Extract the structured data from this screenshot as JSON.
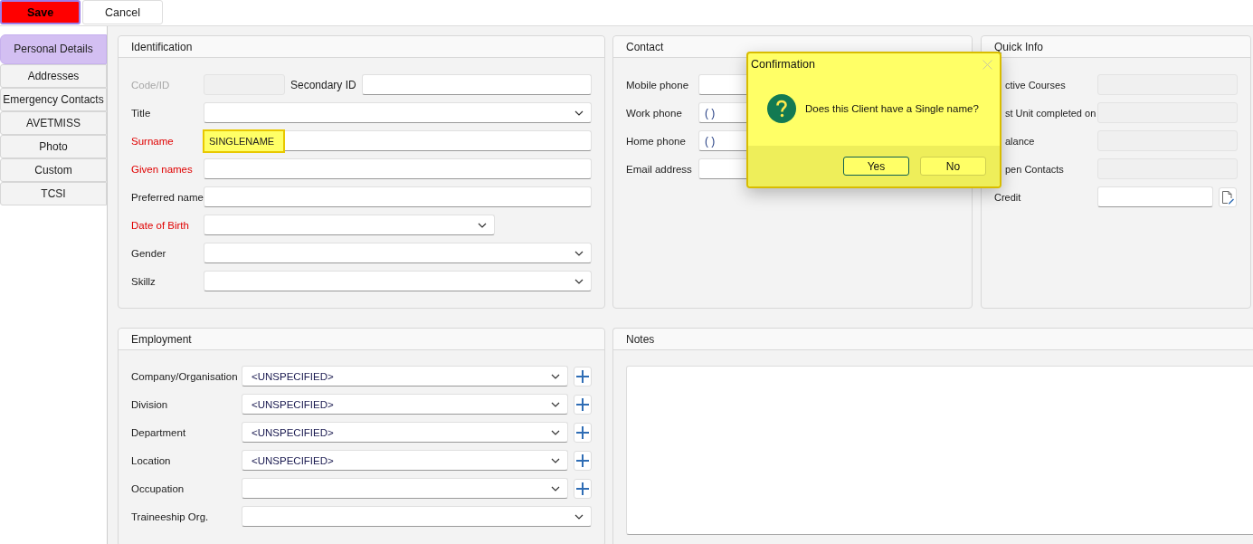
{
  "toolbar": {
    "buttons": [
      {
        "label": "Save",
        "kind": "primary"
      },
      {
        "label": "Cancel",
        "kind": "normal"
      }
    ]
  },
  "sidebar": {
    "tabs": [
      {
        "label": "Personal Details",
        "selected": true
      },
      {
        "label": "Addresses",
        "selected": false
      },
      {
        "label": "Emergency Contacts",
        "selected": false
      },
      {
        "label": "AVETMISS",
        "selected": false
      },
      {
        "label": "Photo",
        "selected": false
      },
      {
        "label": "Custom",
        "selected": false
      },
      {
        "label": "TCSI",
        "selected": false
      }
    ]
  },
  "identification": {
    "title": "Identification",
    "rows": [
      {
        "label": "Code/ID",
        "kind": "pair",
        "required": false,
        "disabled": true,
        "second_label": "Secondary ID"
      },
      {
        "label": "Title",
        "kind": "dropdown",
        "required": false,
        "disabled": false
      },
      {
        "label": "Surname",
        "kind": "text",
        "required": true,
        "disabled": false,
        "value": "SINGLENAME",
        "highlighted": true
      },
      {
        "label": "Given names",
        "kind": "text",
        "required": true,
        "disabled": false
      },
      {
        "label": "Preferred name",
        "kind": "text",
        "required": false,
        "disabled": false
      },
      {
        "label": "Date of Birth",
        "kind": "date",
        "required": true,
        "disabled": false
      },
      {
        "label": "Gender",
        "kind": "dropdown",
        "required": false,
        "disabled": false
      },
      {
        "label": "Skillz",
        "kind": "dropdown",
        "required": false,
        "disabled": false
      }
    ]
  },
  "contact": {
    "title": "Contact",
    "rows": [
      {
        "label": "Mobile phone"
      },
      {
        "label": "Work phone",
        "value": "( )"
      },
      {
        "label": "Home phone",
        "value": "( )"
      },
      {
        "label": "Email address"
      }
    ]
  },
  "quick_info": {
    "title": "Quick Info",
    "rows": [
      {
        "label": "ctive Courses",
        "kind": "text",
        "disabled": true
      },
      {
        "label": "st Unit completed on",
        "kind": "text",
        "disabled": true
      },
      {
        "label": "alance",
        "kind": "text",
        "disabled": true
      },
      {
        "label": "pen Contacts",
        "kind": "text",
        "disabled": true
      },
      {
        "label": "Credit",
        "kind": "edit",
        "disabled": false
      }
    ]
  },
  "employment": {
    "title": "Employment",
    "rows": [
      {
        "label": "Company/Organisation",
        "value": "<UNSPECIFIED>",
        "add": true
      },
      {
        "label": "Division",
        "value": "<UNSPECIFIED>",
        "add": true
      },
      {
        "label": "Department",
        "value": "<UNSPECIFIED>",
        "add": true
      },
      {
        "label": "Location",
        "value": "<UNSPECIFIED>",
        "add": true
      },
      {
        "label": "Occupation",
        "add": true
      },
      {
        "label": "Traineeship Org.",
        "add": false
      }
    ]
  },
  "notes": {
    "title": "Notes"
  },
  "dialog": {
    "title": "Confirmation",
    "message": "Does this Client have a Single name?",
    "buttons": [
      {
        "label": "Yes",
        "default": true
      },
      {
        "label": "No",
        "default": false
      }
    ]
  }
}
